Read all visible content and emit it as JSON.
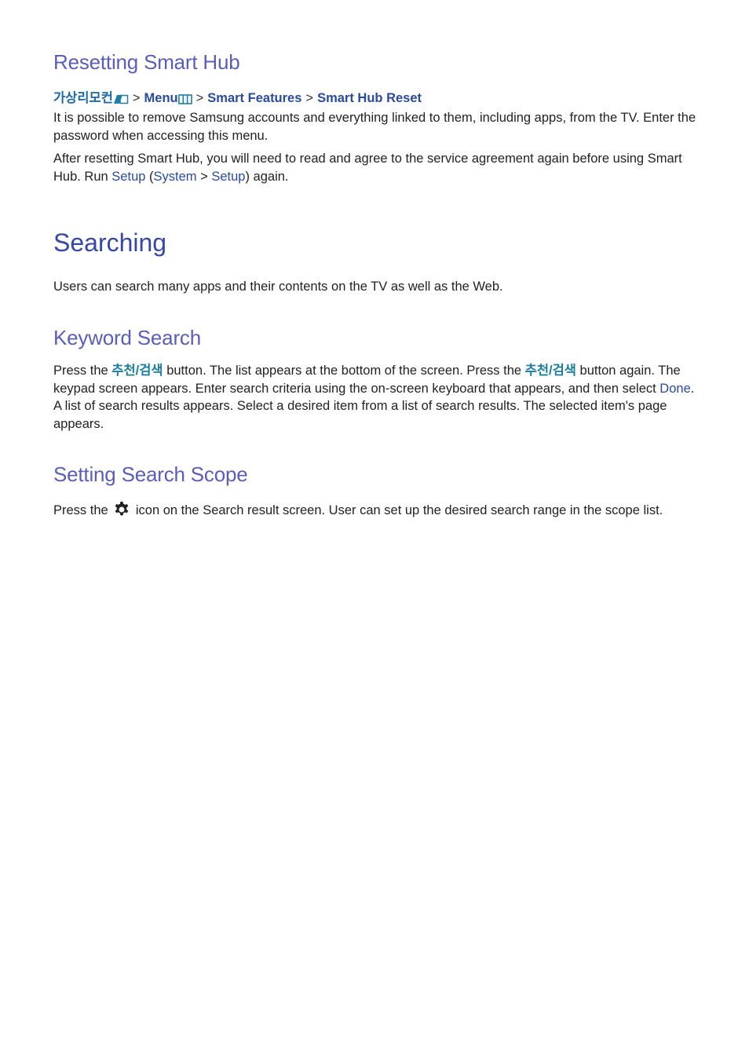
{
  "sections": {
    "resetting": {
      "title": "Resetting Smart Hub",
      "breadcrumb": {
        "remote": "가상리모컨",
        "remote_icon": "virtual-remote-icon",
        "menu": "Menu",
        "menu_icon": "menu-grid-icon",
        "smart_features": "Smart Features",
        "smart_hub_reset": "Smart Hub Reset",
        "separator": ">"
      },
      "para1": "It is possible to remove Samsung accounts and everything linked to them, including apps, from the TV. Enter the password when accessing this menu.",
      "para2_pre": "After resetting Smart Hub, you will need to read and agree to the service agreement again before using Smart Hub. Run ",
      "para2_setup": "Setup",
      "para2_open": " (",
      "para2_system": "System",
      "para2_sep": " > ",
      "para2_setup2": "Setup",
      "para2_post": ") again."
    },
    "searching": {
      "title": "Searching",
      "intro": "Users can search many apps and their contents on the TV as well as the Web."
    },
    "keyword": {
      "title": "Keyword Search",
      "t1": "Press the ",
      "btn1": "추천/검색",
      "t2": " button. The list appears at the bottom of the screen. Press the ",
      "btn2": "추천/검색",
      "t3": " button again. The keypad screen appears. Enter search criteria using the on-screen keyboard that appears, and then select ",
      "done": "Done",
      "t4": ". A list of search results appears. Select a desired item from a list of search results. The selected item's page appears."
    },
    "scope": {
      "title": "Setting Search Scope",
      "t1": "Press the ",
      "icon": "gear-icon",
      "t2": " icon on the Search result screen. User can set up the desired search range in the scope list."
    }
  }
}
